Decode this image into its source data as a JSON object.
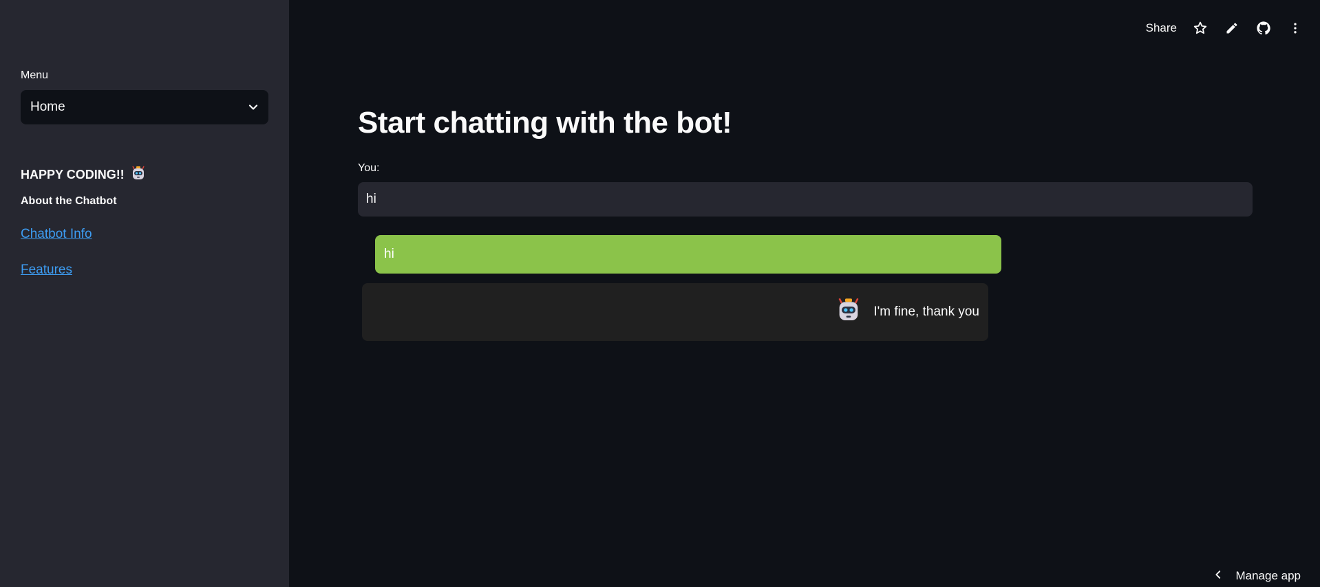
{
  "sidebar": {
    "menu_label": "Menu",
    "menu_selected": "Home",
    "happy_text": "HAPPY CODING!!",
    "about_title": "About the Chatbot",
    "links": [
      "Chatbot Info",
      "Features"
    ]
  },
  "header": {
    "share_label": "Share",
    "icons": [
      "star-icon",
      "pencil-icon",
      "github-icon",
      "more-vert-icon"
    ]
  },
  "main": {
    "title": "Start chatting with the bot!",
    "input_label": "You:",
    "input_value": "hi",
    "messages": [
      {
        "role": "user",
        "text": "hi",
        "color": "#8bc34a"
      },
      {
        "role": "bot",
        "text": "I'm fine, thank you",
        "color": "#202020"
      }
    ]
  },
  "footer": {
    "manage_label": "Manage app"
  },
  "colors": {
    "background": "#0e1117",
    "sidebar": "#262730",
    "link": "#3d9df3",
    "user_bubble": "#8bc34a"
  }
}
